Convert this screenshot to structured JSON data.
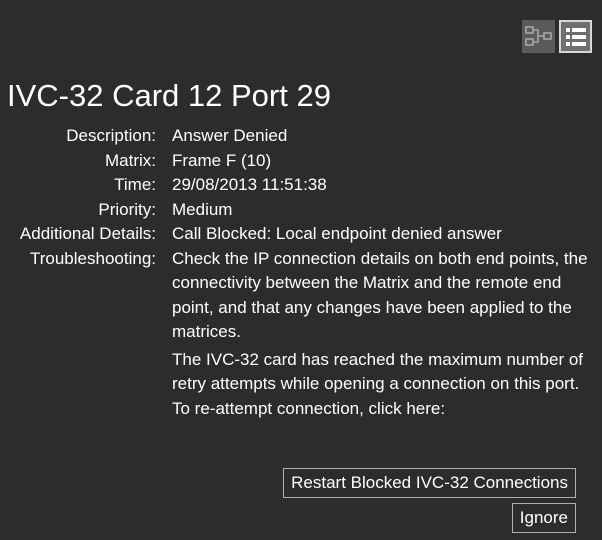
{
  "toolbar": {
    "view_toggle": [
      {
        "icon": "network-topology-icon",
        "state": "inactive"
      },
      {
        "icon": "list-view-icon",
        "state": "active"
      }
    ]
  },
  "title": "IVC-32 Card 12 Port 29",
  "details": {
    "description": {
      "label": "Description:",
      "value": "Answer Denied"
    },
    "matrix": {
      "label": "Matrix:",
      "value": "Frame F (10)"
    },
    "time": {
      "label": "Time:",
      "value": "29/08/2013 11:51:38"
    },
    "priority": {
      "label": "Priority:",
      "value": "Medium"
    },
    "additional_details": {
      "label": "Additional Details:",
      "value": "Call Blocked: Local endpoint denied answer"
    },
    "troubleshooting": {
      "label": "Troubleshooting:",
      "paragraphs": [
        "Check the IP connection details on both end points, the connectivity between the Matrix and the remote end point, and that any changes have been applied to the matrices.",
        "The IVC-32 card has reached the maximum number of retry attempts while opening a connection on this port. To re-attempt connection, click here:"
      ]
    }
  },
  "actions": {
    "restart_label": "Restart Blocked IVC-32 Connections",
    "ignore_label": "Ignore"
  },
  "colors": {
    "background": "#2c2c2c",
    "text": "#ffffff",
    "button_border": "#b0b0b0",
    "toggle_active": "#6f6f6f",
    "toggle_inactive": "#5a5a5a"
  }
}
